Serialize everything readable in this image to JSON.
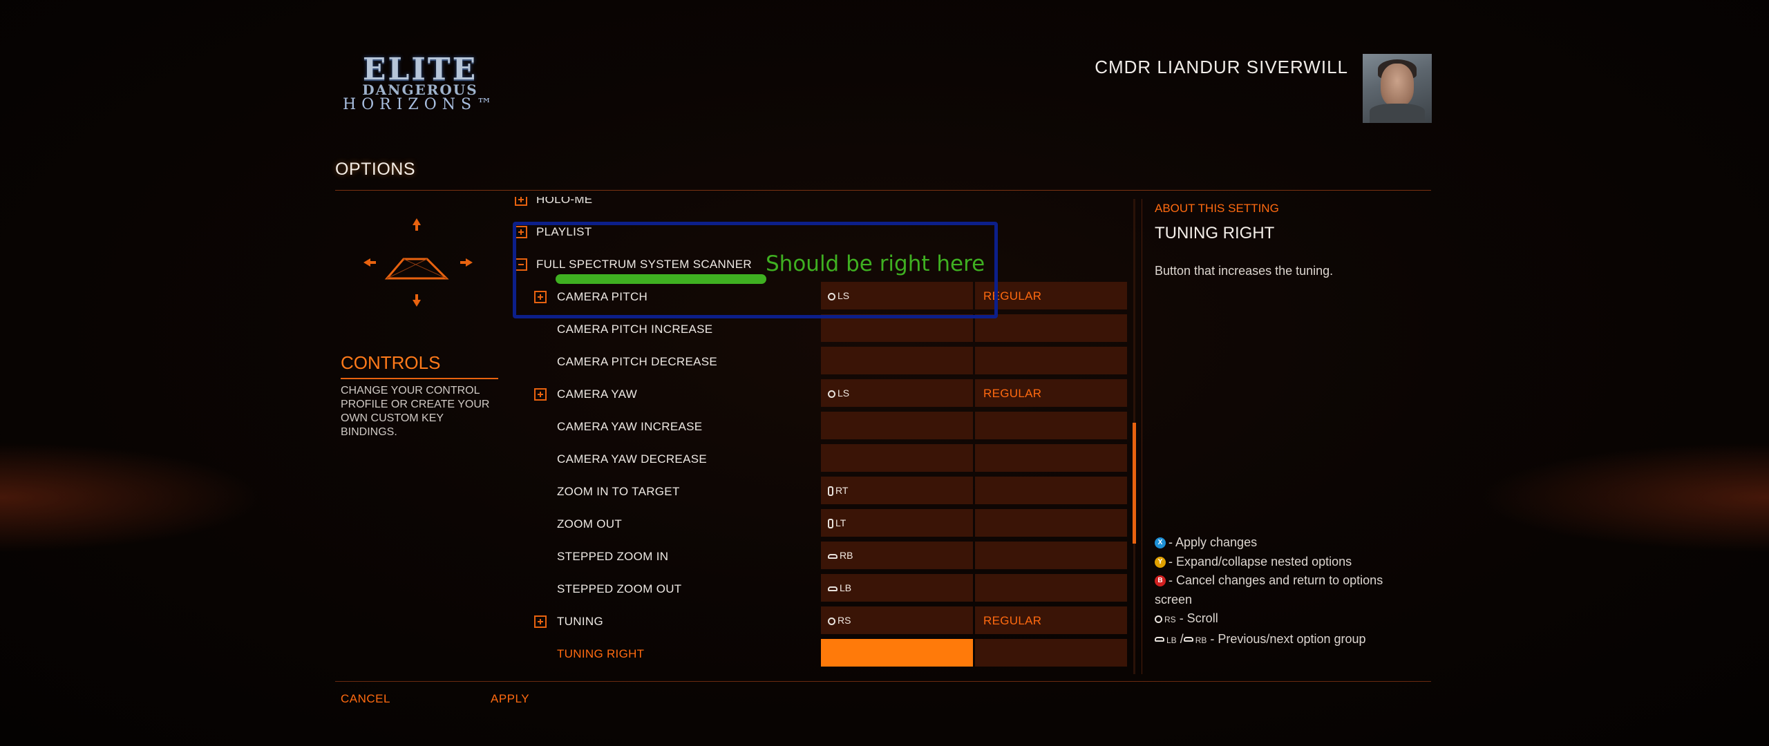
{
  "logo": {
    "line1": "ELITE",
    "line2": "DANGEROUS",
    "line3": "HORIZONS™"
  },
  "commander": {
    "name": "CMDR LIANDUR SIVERWILL"
  },
  "page": {
    "title": "OPTIONS"
  },
  "left_panel": {
    "title": "CONTROLS",
    "description": "CHANGE YOUR CONTROL PROFILE OR CREATE YOUR OWN CUSTOM KEY BINDINGS."
  },
  "list": {
    "rows": [
      {
        "label": "HOLO-ME",
        "expander": "plus"
      },
      {
        "label": "PLAYLIST",
        "expander": "plus"
      },
      {
        "label": "FULL SPECTRUM SYSTEM SCANNER",
        "expander": "minus"
      },
      {
        "label": "CAMERA PITCH",
        "expander": "plus",
        "binding": "LS",
        "binding_icon": "stick-icon",
        "mode": "REGULAR"
      },
      {
        "label": "CAMERA PITCH INCREASE"
      },
      {
        "label": "CAMERA PITCH DECREASE"
      },
      {
        "label": "CAMERA YAW",
        "expander": "plus",
        "binding": "LS",
        "binding_icon": "stick-icon",
        "mode": "REGULAR"
      },
      {
        "label": "CAMERA YAW INCREASE"
      },
      {
        "label": "CAMERA YAW DECREASE"
      },
      {
        "label": "ZOOM IN TO TARGET",
        "binding": "RT",
        "binding_icon": "trigger-icon"
      },
      {
        "label": "ZOOM OUT",
        "binding": "LT",
        "binding_icon": "trigger-icon"
      },
      {
        "label": "STEPPED ZOOM IN",
        "binding": "RB",
        "binding_icon": "bumper-icon"
      },
      {
        "label": "STEPPED ZOOM OUT",
        "binding": "LB",
        "binding_icon": "bumper-icon"
      },
      {
        "label": "TUNING",
        "expander": "plus",
        "binding": "RS",
        "binding_icon": "stick-icon",
        "mode": "REGULAR"
      },
      {
        "label": "TUNING RIGHT",
        "selected": true
      }
    ]
  },
  "annotation": {
    "text": "Should be right here",
    "box_color": "#0c1f8a",
    "text_color": "#3fb021"
  },
  "right_panel": {
    "header": "ABOUT THIS SETTING",
    "title": "TUNING RIGHT",
    "description": "Button that increases the tuning.",
    "help": {
      "apply": "- Apply changes",
      "expand": "- Expand/collapse nested options",
      "cancel": "- Cancel changes and return to options screen",
      "scroll_key": "RS",
      "scroll": "- Scroll",
      "lb": "LB",
      "sep": "/",
      "rb": "RB",
      "prevnext": "- Previous/next option group"
    }
  },
  "footer": {
    "cancel": "CANCEL",
    "apply": "APPLY"
  },
  "colors": {
    "accent": "#e8620f",
    "highlight": "#ff7a0a",
    "cell_bg": "#3a1406"
  }
}
